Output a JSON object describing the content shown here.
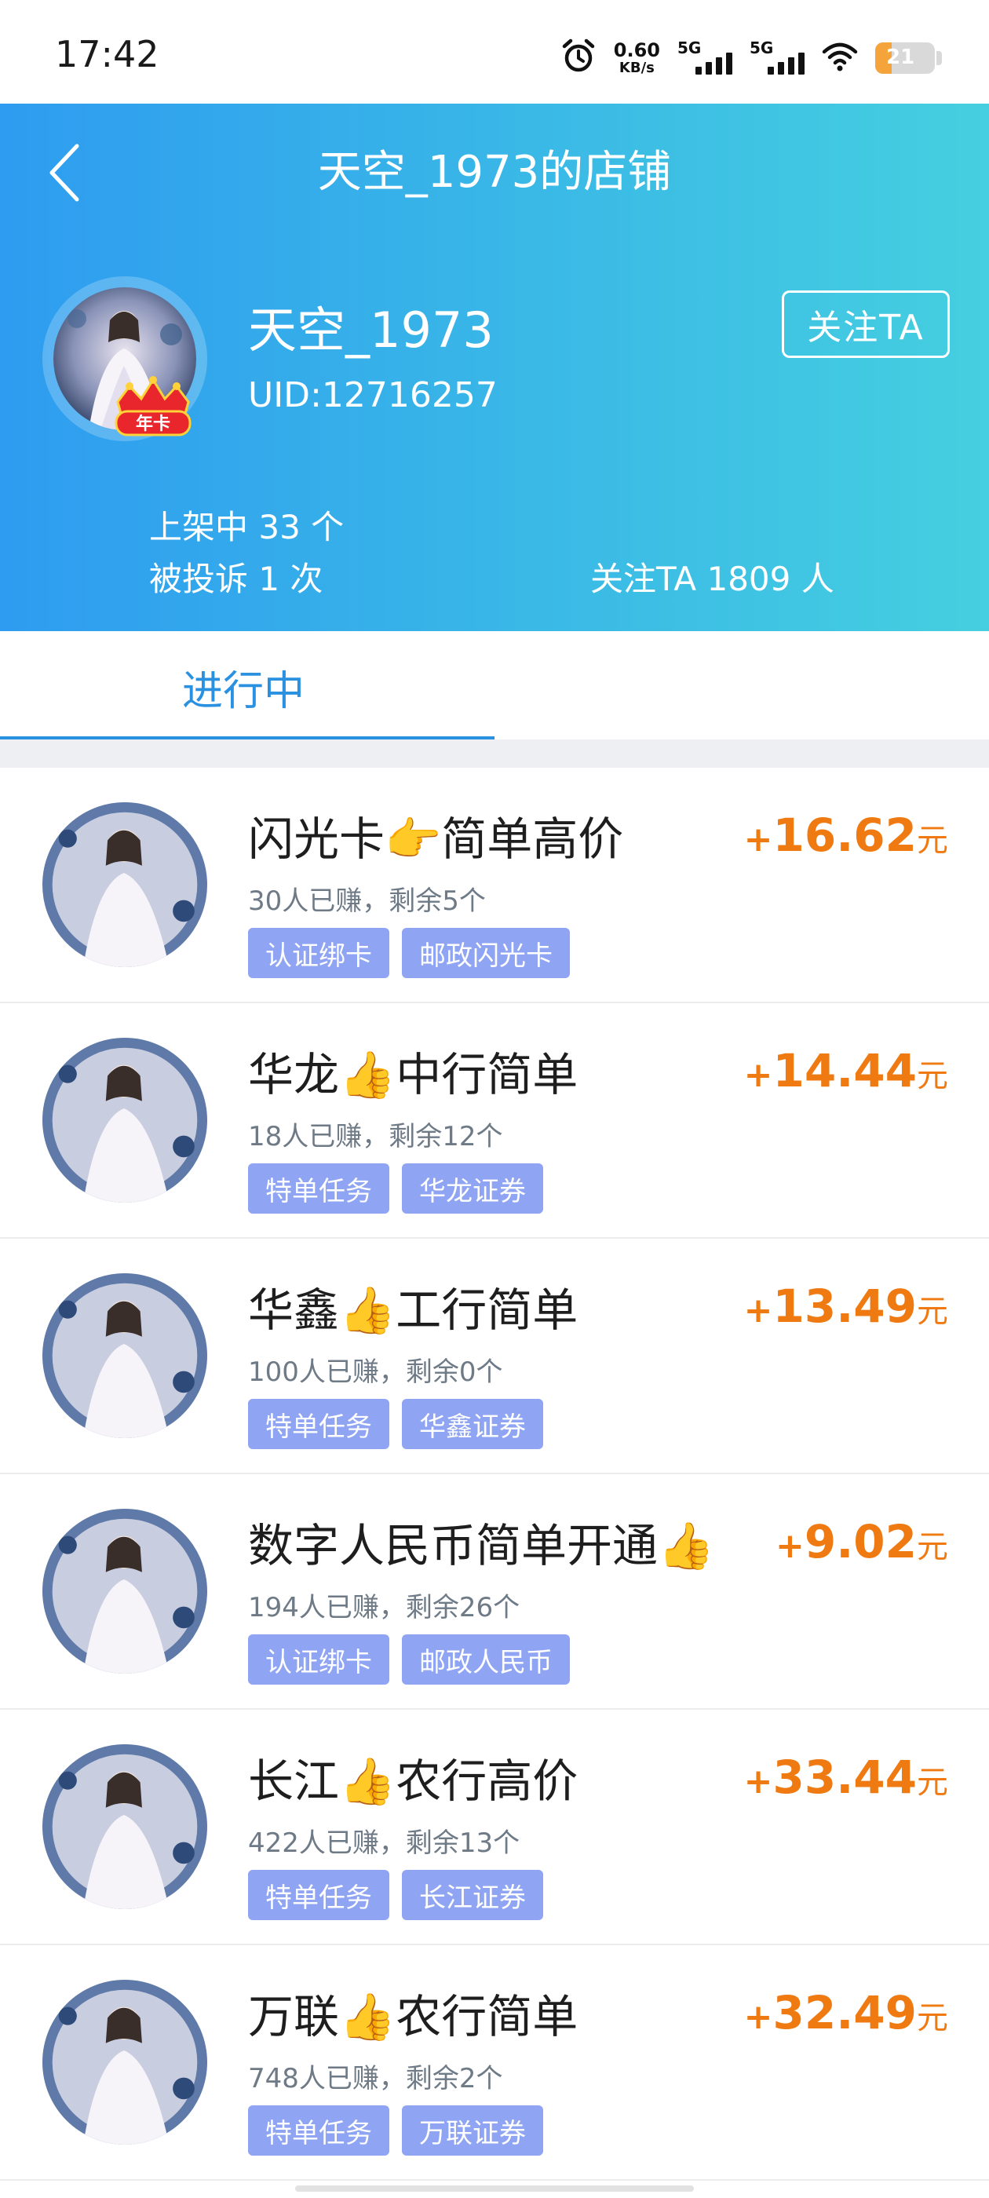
{
  "status_bar": {
    "time": "17:42",
    "net_speed_value": "0.60",
    "net_speed_unit": "KB/s",
    "sim1_label": "5G",
    "sim2_label": "5G",
    "battery": "21",
    "icons": [
      "alarm-icon",
      "signal-icon",
      "wifi-icon",
      "battery-icon"
    ]
  },
  "header": {
    "title": "天空_1973的店铺",
    "user_name": "天空_1973",
    "uid": "UID:12716257",
    "badge": "年卡",
    "follow_button": "关注TA",
    "listed": "上架中 33 个",
    "complaints": "被投诉 1 次",
    "followers": "关注TA 1809 人"
  },
  "tabs": [
    {
      "label": "进行中",
      "active": true
    }
  ],
  "tasks": [
    {
      "title": "闪光卡👉简单高价",
      "stats": "30人已赚，剩余5个",
      "tags": [
        "认证绑卡",
        "邮政闪光卡"
      ],
      "plus": "+",
      "price": "16.62",
      "unit": "元"
    },
    {
      "title": "华龙👍中行简单",
      "stats": "18人已赚，剩余12个",
      "tags": [
        "特单任务",
        "华龙证券"
      ],
      "plus": "+",
      "price": "14.44",
      "unit": "元"
    },
    {
      "title": "华鑫👍工行简单",
      "stats": "100人已赚，剩余0个",
      "tags": [
        "特单任务",
        "华鑫证券"
      ],
      "plus": "+",
      "price": "13.49",
      "unit": "元"
    },
    {
      "title": "数字人民币简单开通👍",
      "stats": "194人已赚，剩余26个",
      "tags": [
        "认证绑卡",
        "邮政人民币"
      ],
      "plus": "+",
      "price": "9.02",
      "unit": "元"
    },
    {
      "title": "长江👍农行高价",
      "stats": "422人已赚，剩余13个",
      "tags": [
        "特单任务",
        "长江证券"
      ],
      "plus": "+",
      "price": "33.44",
      "unit": "元"
    },
    {
      "title": "万联👍农行简单",
      "stats": "748人已赚，剩余2个",
      "tags": [
        "特单任务",
        "万联证券"
      ],
      "plus": "+",
      "price": "32.49",
      "unit": "元"
    }
  ],
  "colors": {
    "header_gradient_start": "#2e9cf0",
    "header_gradient_end": "#45cfe0",
    "accent_blue": "#2a90e0",
    "price_orange": "#f07a12",
    "tag_bg": "#8fa4f2"
  }
}
